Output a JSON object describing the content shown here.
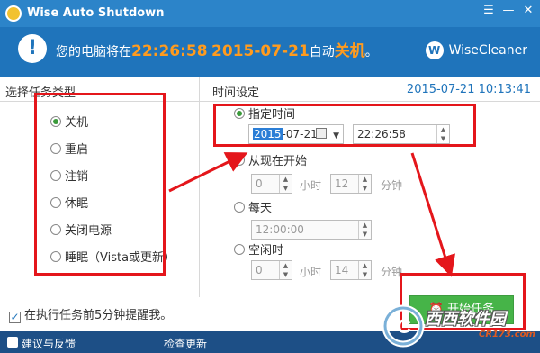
{
  "window": {
    "title": "Wise Auto Shutdown",
    "buttons": {
      "menu": "☰",
      "minimize": "—",
      "close": "✕"
    }
  },
  "header": {
    "message_prefix": "您的电脑将在",
    "time": "22:26:58",
    "date": "2015-07-21",
    "message_mid": "自动",
    "action": "关机",
    "message_suffix": "。",
    "brand": "WiseCleaner",
    "brand_logo_letter": "W"
  },
  "task_type": {
    "title": "选择任务类型",
    "options": [
      {
        "label": "关机",
        "selected": true
      },
      {
        "label": "重启",
        "selected": false
      },
      {
        "label": "注销",
        "selected": false
      },
      {
        "label": "休眠",
        "selected": false
      },
      {
        "label": "关闭电源",
        "selected": false
      },
      {
        "label": "睡眠（Vista或更新）",
        "selected": false
      }
    ]
  },
  "time_settings": {
    "title": "时间设定",
    "current_datetime": "2015-07-21 10:13:41",
    "specified": {
      "label": "指定时间",
      "selected": true,
      "date_selected_part": "2015",
      "date_rest": "-07-21",
      "time": "22:26:58"
    },
    "from_now": {
      "label": "从现在开始",
      "hours": "0",
      "hours_unit": "小时",
      "minutes": "12",
      "minutes_unit": "分钟"
    },
    "daily": {
      "label": "每天",
      "time": "12:00:00"
    },
    "idle": {
      "label": "空闲时",
      "hours": "0",
      "hours_unit": "小时",
      "minutes": "14",
      "minutes_unit": "分钟"
    }
  },
  "start_button": "开始任务",
  "remind": {
    "label": "在执行任务前5分钟提醒我。",
    "checked": true
  },
  "footer": {
    "feedback": "建议与反馈",
    "check_update": "检查更新"
  },
  "watermark": {
    "text": "西西软件园",
    "url": "CR173.com",
    "logo_letter": "C"
  },
  "colors": {
    "titlebar": "#2c84c9",
    "header": "#1f74bb",
    "highlight": "#ff9b1e",
    "annotation_red": "#e4161b",
    "start_green": "#46b448",
    "footer": "#1d4f86"
  }
}
